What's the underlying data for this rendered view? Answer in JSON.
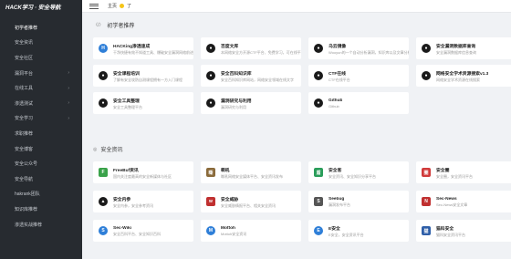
{
  "brand": "HACK学习 · 安全导航",
  "topbar": {
    "home": "主页",
    "extra": "了"
  },
  "sidebar": {
    "items": [
      {
        "label": "初学者推荐",
        "chevron": false,
        "active": true
      },
      {
        "label": "安全资讯",
        "chevron": false
      },
      {
        "label": "安全社区",
        "chevron": false
      },
      {
        "label": "漏洞平台",
        "chevron": true
      },
      {
        "label": "在线工具",
        "chevron": true
      },
      {
        "label": "渗透测试",
        "chevron": true
      },
      {
        "label": "安全学习",
        "chevron": true
      },
      {
        "label": "求职推荐",
        "chevron": false
      },
      {
        "label": "安全博客",
        "chevron": false
      },
      {
        "label": "安全公众号",
        "chevron": false
      },
      {
        "label": "安全导航",
        "chevron": false
      },
      {
        "label": "hakrank团队",
        "chevron": false
      },
      {
        "label": "知识库推荐",
        "chevron": false
      },
      {
        "label": "渗透实战推荐",
        "chevron": false
      }
    ]
  },
  "sections": [
    {
      "tag": "〈/〉",
      "title": "初学者推荐",
      "cards": [
        {
          "title": "HACKing渗透速成",
          "desc": "干净快捷有效不知道工具、爆破安全漏洞网络前进分析自学者入门教程",
          "icon": "h-icon",
          "color": "#2f7fd8",
          "glyph": "H",
          "shape": "circle"
        },
        {
          "title": "百度文库",
          "desc": "本网络安全方开源CTF平台、免费学习，可在线平台技能学习培训",
          "icon": "library-icon",
          "color": "#1a1a1a",
          "glyph": "●",
          "shape": "circle"
        },
        {
          "title": "乌云镜像",
          "desc": "Wooyun的一个自动分析漏洞，知识库以及文章分析漏洞存储实时同步",
          "icon": "mirror-icon",
          "color": "#1a1a1a",
          "glyph": "●",
          "shape": "circle"
        },
        {
          "title": "安全漏洞数据库查询",
          "desc": "安全漏洞数据库信息查询",
          "icon": "database-icon",
          "color": "#1a1a1a",
          "glyph": "●",
          "shape": "circle"
        },
        {
          "title": "安全课程培训",
          "desc": "了解有安全攻防自测课程拥有一方入门课程",
          "icon": "course-icon",
          "color": "#1a1a1a",
          "glyph": "●",
          "shape": "circle"
        },
        {
          "title": "安全百科知识库",
          "desc": "安全百科知识库网站，网络安全领域在线文字",
          "icon": "wiki-icon",
          "color": "#1a1a1a",
          "glyph": "●",
          "shape": "circle"
        },
        {
          "title": "CTF在线",
          "desc": "CTF在线平台",
          "icon": "ctf-icon",
          "color": "#1a1a1a",
          "glyph": "●",
          "shape": "circle"
        },
        {
          "title": "网络安全学术资源搜索v1.3",
          "desc": "网络安全学术资源在线搜索",
          "icon": "search-icon",
          "color": "#1a1a1a",
          "glyph": "●",
          "shape": "circle"
        },
        {
          "title": "安全工具整理",
          "desc": "安全工具整理平台",
          "icon": "tool-icon",
          "color": "#1a1a1a",
          "glyph": "●",
          "shape": "circle"
        },
        {
          "title": "漏洞研究与利用",
          "desc": "漏洞研究与利用",
          "icon": "exploit-icon",
          "color": "#1a1a1a",
          "glyph": "●",
          "shape": "circle"
        },
        {
          "title": "Github",
          "desc": "Github",
          "icon": "github-icon",
          "color": "#1a1a1a",
          "glyph": "●",
          "shape": "circle"
        }
      ]
    },
    {
      "tag": "◎",
      "title": "安全资讯",
      "cards": [
        {
          "title": "FreeBuf资讯",
          "desc": "国内关注度最高的安全新媒体与社区",
          "icon": "freebuf-icon",
          "color": "#3aa24a",
          "glyph": "F",
          "shape": "sq"
        },
        {
          "title": "嘶吼",
          "desc": "嘶吼网络安全媒体平台、安全资讯发布",
          "icon": "sihou-icon",
          "color": "#8a6a3a",
          "glyph": "嘶",
          "shape": "sq"
        },
        {
          "title": "安全客",
          "desc": "安全资讯、安全知识分享平台",
          "icon": "shield-icon",
          "color": "#2a9d5a",
          "glyph": "盾",
          "shape": "sq"
        },
        {
          "title": "安全圈",
          "desc": "安全圈，安全资讯平台",
          "icon": "circle-icon",
          "color": "#d03a3a",
          "glyph": "圈",
          "shape": "sq"
        },
        {
          "title": "安全内参",
          "desc": "安全内参，安全参考资讯",
          "icon": "arrow-icon",
          "color": "#1a1a1a",
          "glyph": "▲",
          "shape": "circle"
        },
        {
          "title": "安全威胁",
          "desc": "安全威胁情报平台、相关安全资讯",
          "icon": "wtf-icon",
          "color": "#c03030",
          "glyph": "w",
          "shape": "sq"
        },
        {
          "title": "Seebug",
          "desc": "漏洞发布平台",
          "icon": "seebug-icon",
          "color": "#555555",
          "glyph": "S",
          "shape": "sq"
        },
        {
          "title": "Sec-News",
          "desc": "Sec-News安全文章",
          "icon": "news-icon",
          "color": "#c03030",
          "glyph": "N",
          "shape": "sq"
        },
        {
          "title": "Sec-Wiki",
          "desc": "安全百科平台、安全知识百科",
          "icon": "wiki2-icon",
          "color": "#2f7fd8",
          "glyph": "S",
          "shape": "circle"
        },
        {
          "title": "Mottoh",
          "desc": "Mottoh安全资讯",
          "icon": "mottoh-icon",
          "color": "#2f7fd8",
          "glyph": "M",
          "shape": "circle"
        },
        {
          "title": "E安全",
          "desc": "E安全，安全资讯平台",
          "icon": "e-icon",
          "color": "#2f7fd8",
          "glyph": "E",
          "shape": "circle"
        },
        {
          "title": "猫科安全",
          "desc": "猫科安全资讯平台",
          "icon": "cat-icon",
          "color": "#2f5fa8",
          "glyph": "猫",
          "shape": "sq"
        }
      ]
    }
  ]
}
